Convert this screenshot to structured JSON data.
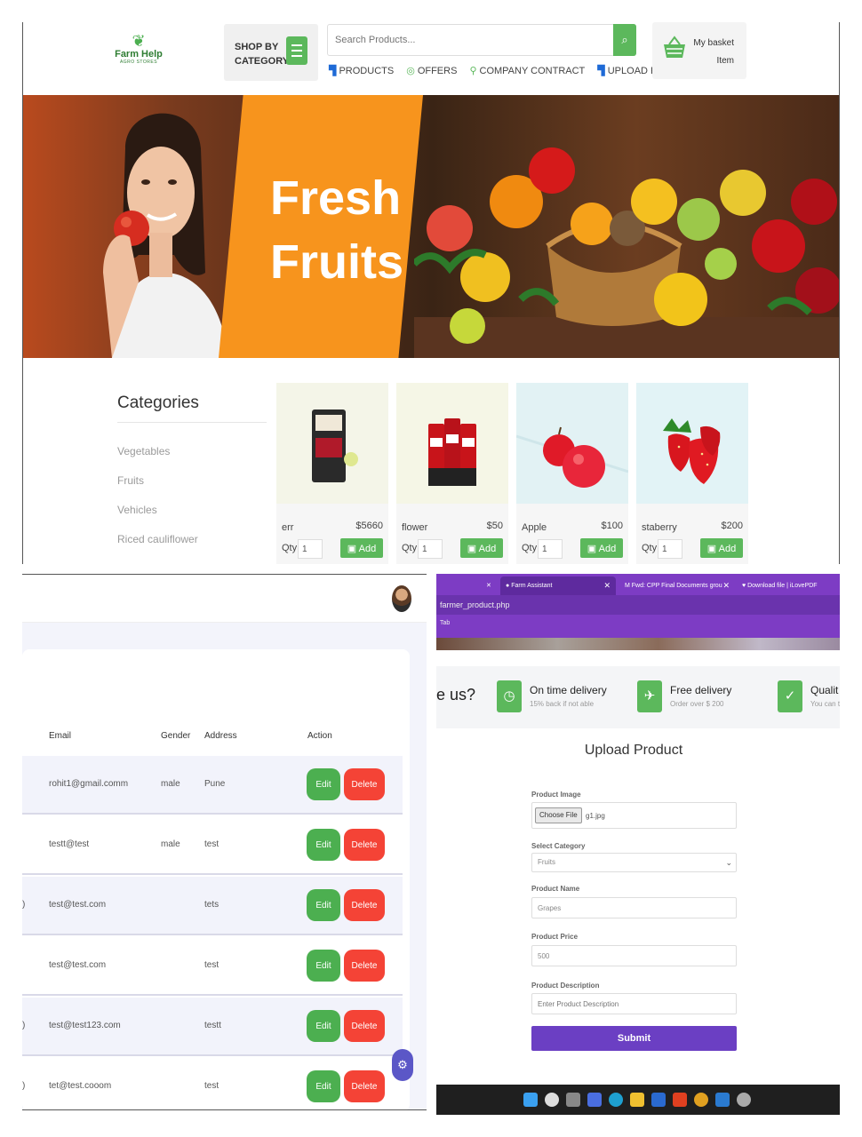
{
  "store": {
    "logo": {
      "name": "Farm Help",
      "sub": "AGRO STORES"
    },
    "shop_by": {
      "line1": "SHOP BY",
      "line2": "CATEGORY"
    },
    "search": {
      "placeholder": "Search Products..."
    },
    "nav": [
      "PRODUCTS",
      "OFFERS",
      "COMPANY CONTRACT",
      "UPLOAD PRODUCT"
    ],
    "basket": {
      "line1": "My basket",
      "line2": "Item"
    },
    "hero": {
      "line1": "Fresh",
      "line2": "Fruits"
    },
    "categories": {
      "title": "Categories",
      "items": [
        "Vegetables",
        "Fruits",
        "Vehicles",
        "Riced cauliflower"
      ]
    },
    "products": [
      {
        "name": "err",
        "price": "$5660",
        "qty_label": "Qty",
        "qty": "1",
        "add": "Add"
      },
      {
        "name": "flower",
        "price": "$50",
        "qty_label": "Qty",
        "qty": "1",
        "add": "Add"
      },
      {
        "name": "Apple",
        "price": "$100",
        "qty_label": "Qty",
        "qty": "1",
        "add": "Add"
      },
      {
        "name": "staberry",
        "price": "$200",
        "qty_label": "Qty",
        "qty": "1",
        "add": "Add"
      }
    ]
  },
  "users": {
    "headers": {
      "email": "Email",
      "gender": "Gender",
      "address": "Address",
      "action": "Action"
    },
    "rows": [
      {
        "lead": "",
        "email": "rohit1@gmail.comm",
        "gender": "male",
        "address": "Pune",
        "edit": "Edit",
        "delete": "Delete"
      },
      {
        "lead": "",
        "email": "testt@test",
        "gender": "male",
        "address": "test",
        "edit": "Edit",
        "delete": "Delete"
      },
      {
        "lead": ")",
        "email": "test@test.com",
        "gender": "",
        "address": "tets",
        "edit": "Edit",
        "delete": "Delete"
      },
      {
        "lead": "",
        "email": "test@test.com",
        "gender": "",
        "address": "test",
        "edit": "Edit",
        "delete": "Delete"
      },
      {
        "lead": ")",
        "email": "test@test123.com",
        "gender": "",
        "address": "testt",
        "edit": "Edit",
        "delete": "Delete"
      },
      {
        "lead": ")",
        "email": "tet@test.cooom",
        "gender": "",
        "address": "test",
        "edit": "Edit",
        "delete": "Delete"
      }
    ]
  },
  "upload": {
    "tabs": [
      "Farm Assistant",
      "Fwd: CPP Final Documents grou",
      "Download file | iLovePDF"
    ],
    "url": "farmer_product.php",
    "bookmark": "Tab",
    "why_text": "e us?",
    "features": [
      {
        "title": "On time delivery",
        "sub": "15% back if not able",
        "icon": "clock-icon"
      },
      {
        "title": "Free delivery",
        "sub": "Order over $ 200",
        "icon": "plane-icon"
      },
      {
        "title": "Qualit",
        "sub": "You can t",
        "icon": "check-icon"
      }
    ],
    "title": "Upload Product",
    "image_label": "Product Image",
    "choose_file": "Choose File",
    "file_name": "g1.jpg",
    "category_label": "Select Category",
    "category_value": "Fruits",
    "name_label": "Product Name",
    "name_value": "Grapes",
    "price_label": "Product Price",
    "price_value": "500",
    "desc_label": "Product Description",
    "desc_placeholder": "Enter Product Description",
    "submit": "Submit"
  },
  "colors": {
    "green": "#5cb85c",
    "red": "#f44336",
    "purple": "#6b3fc3",
    "orange": "#f7941d"
  }
}
